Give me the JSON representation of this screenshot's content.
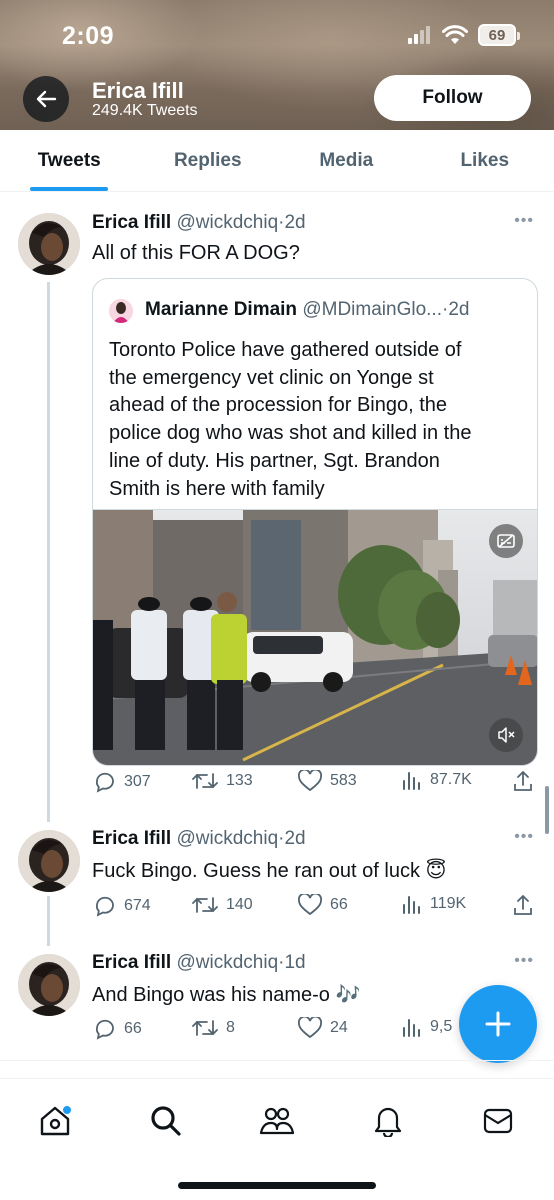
{
  "status_bar": {
    "time": "2:09",
    "battery": "69"
  },
  "header": {
    "name": "Erica Ifill",
    "tweet_count": "249.4K Tweets",
    "follow_label": "Follow"
  },
  "tabs": [
    {
      "label": "Tweets",
      "active": true
    },
    {
      "label": "Replies"
    },
    {
      "label": "Media"
    },
    {
      "label": "Likes"
    }
  ],
  "tweets": [
    {
      "name": "Erica Ifill",
      "handle": "@wickdchiq",
      "time": "2d",
      "text": "All of this FOR A DOG?",
      "quote": {
        "name": "Marianne Dimain",
        "handle": "@MDimainGlo...",
        "time": "2d",
        "lines": [
          "Toronto Police have gathered outside of",
          "the emergency vet clinic on Yonge st",
          "ahead of the procession for Bingo, the",
          "police dog who was shot and killed in the",
          "line of duty. His partner, Sgt. Brandon",
          "Smith is here with family"
        ]
      },
      "replies": "307",
      "retweets": "133",
      "likes": "583",
      "views": "87.7K"
    },
    {
      "name": "Erica Ifill",
      "handle": "@wickdchiq",
      "time": "2d",
      "text": "Fuck Bingo. Guess he ran out of luck 😇",
      "replies": "674",
      "retweets": "140",
      "likes": "66",
      "views": "119K"
    },
    {
      "name": "Erica Ifill",
      "handle": "@wickdchiq",
      "time": "1d",
      "text": "And Bingo was his name-o 🎶",
      "replies": "66",
      "retweets": "8",
      "likes": "24",
      "views": "9,5"
    }
  ],
  "colors": {
    "accent": "#1d9bf0",
    "text": "#0f1419",
    "muted": "#536471"
  },
  "icons": [
    "back-arrow-icon",
    "more-icon",
    "reply-icon",
    "retweet-icon",
    "like-icon",
    "views-icon",
    "share-icon",
    "home-icon",
    "search-icon",
    "communities-icon",
    "notifications-icon",
    "messages-icon",
    "compose-icon"
  ]
}
